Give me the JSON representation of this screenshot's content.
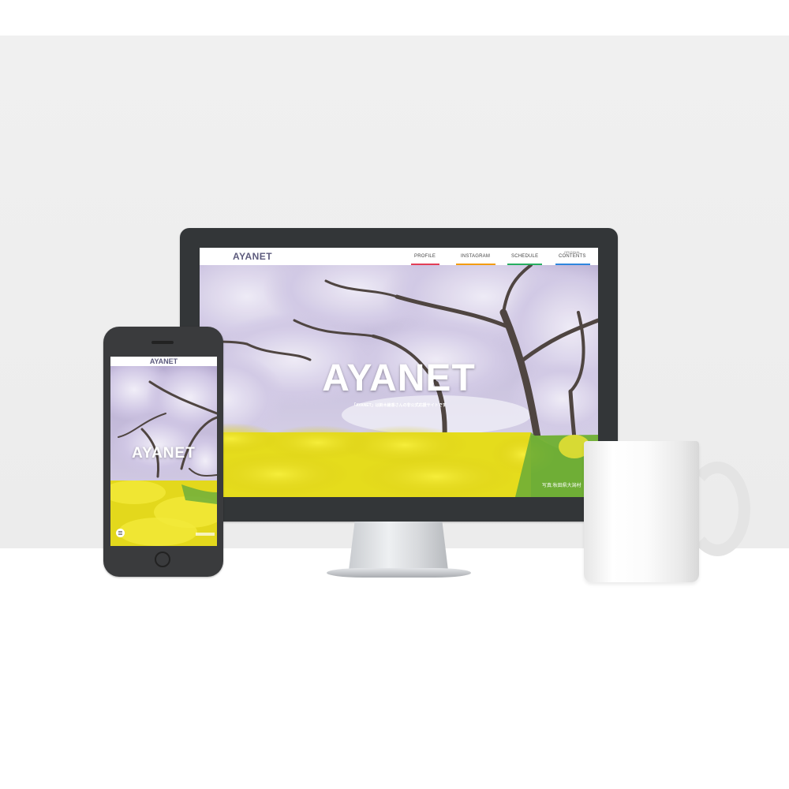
{
  "site": {
    "logo": "AYANET",
    "nav": [
      {
        "label": "PROFILE"
      },
      {
        "label": "INSTAGRAM"
      },
      {
        "label": "SCHEDULE"
      },
      {
        "small": "ORIGINAL",
        "label": "CONTENTS"
      }
    ],
    "hero": {
      "title": "AYANET",
      "subtitle": "「AYANET」は鈴木綾香さんの非公式応援サイトです",
      "credit": "写真:秋田県大潟村"
    }
  },
  "mobile": {
    "logo": "AYANET",
    "hero_title": "AYANET"
  },
  "colors": {
    "logo": "#5d5b7d",
    "sky": "#c9c2de",
    "blossom": "#e2dcee",
    "blossom_shadow": "#b3a8cf",
    "rapeseed": "#e5dc1c",
    "grass": "#74b13b",
    "trunk": "#4f4541",
    "device_frame": "#333638",
    "nav_underlines": [
      "#e23e57",
      "#f39c12",
      "#27ae60",
      "#2e86de"
    ]
  },
  "icons": [
    "menu-icon"
  ]
}
